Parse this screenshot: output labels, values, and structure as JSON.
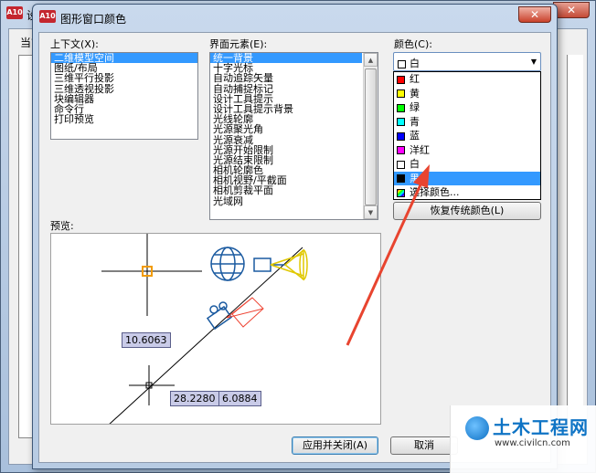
{
  "background_window": {
    "title": "设",
    "label": "当前",
    "close_glyph": "✕"
  },
  "dialog": {
    "app_badge": "A10",
    "title": "图形窗口颜色",
    "close_glyph": "✕"
  },
  "context": {
    "label": "上下文(X):",
    "items": [
      "二维模型空间",
      "图纸/布局",
      "三维平行投影",
      "三维透视投影",
      "块编辑器",
      "命令行",
      "打印预览"
    ],
    "selected_index": 0
  },
  "interface_elements": {
    "label": "界面元素(E):",
    "items": [
      "统一背景",
      "十字光标",
      "自动追踪矢量",
      "自动捕捉标记",
      "设计工具提示",
      "设计工具提示背景",
      "光线轮廓",
      "光源聚光角",
      "光源衰减",
      "光源开始限制",
      "光源结束限制",
      "相机轮廓色",
      "相机视野/平截面",
      "相机剪裁平面",
      "光域网"
    ],
    "selected_index": 0
  },
  "color": {
    "label": "颜色(C):",
    "current_value": "白",
    "current_swatch": "#ffffff",
    "options": [
      {
        "label": "红",
        "swatch": "#ff0000"
      },
      {
        "label": "黄",
        "swatch": "#ffff00"
      },
      {
        "label": "绿",
        "swatch": "#00ff00"
      },
      {
        "label": "青",
        "swatch": "#00ffff"
      },
      {
        "label": "蓝",
        "swatch": "#0000ff"
      },
      {
        "label": "洋红",
        "swatch": "#ff00ff"
      },
      {
        "label": "白",
        "swatch": "#ffffff"
      },
      {
        "label": "黑",
        "swatch": "#000000"
      },
      {
        "label": "选择颜色...",
        "swatch": "multicolor"
      }
    ],
    "highlighted_index": 7,
    "restore_button": "恢复传统颜色(L)"
  },
  "preview": {
    "label": "预览:",
    "dim_values": [
      "10.6063",
      "28.2280",
      "6.0884"
    ]
  },
  "buttons": {
    "apply_close": "应用并关闭(A)",
    "cancel": "取消"
  },
  "watermark": {
    "title": "土木工程网",
    "url": "www.civilcn.com"
  },
  "annotation_color": "#e8442f"
}
